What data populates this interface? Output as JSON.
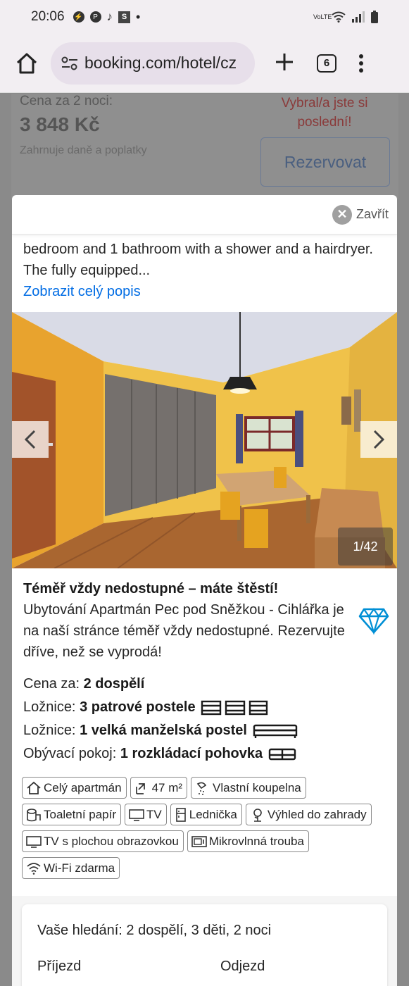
{
  "status_bar": {
    "time": "20:06",
    "icons": [
      "messenger-icon",
      "pinterest-icon",
      "tiktok-icon",
      "s-app-icon",
      "dot-icon"
    ],
    "right_icons": [
      "volte-icon",
      "wifi-icon",
      "signal-icon",
      "battery-icon"
    ],
    "volte_label": "VoLTE"
  },
  "browser": {
    "url": "booking.com/hotel/cz",
    "tab_count": "6"
  },
  "background_page": {
    "price_label": "Cena za 2 noci:",
    "price": "3 848 Kč",
    "taxes": "Zahrnuje daně a poplatky",
    "last_chance": "Vybral/a jste si poslední!",
    "reserve_button": "Rezervovat"
  },
  "modal": {
    "close_label": "Zavřít",
    "description": "bedroom and 1 bathroom with a shower and a hairdryer. The fully equipped...",
    "show_more": "Zobrazit celý popis",
    "gallery_counter": "1/42",
    "scarcity_title": "Téměř vždy nedostupné – máte štěstí!",
    "scarcity_text": "Ubytování Apartmán Pec pod Sněžkou - Cihlářka je na naší stránce téměř vždy nedostupné. Rezervujte dříve, než se vyprodá!",
    "specs": [
      {
        "label": "Cena za: ",
        "value": "2 dospělí"
      },
      {
        "label": "Ložnice: ",
        "value": "3 patrové postele"
      },
      {
        "label": "Ložnice: ",
        "value": "1 velká manželská postel"
      },
      {
        "label": "Obývací pokoj: ",
        "value": "1 rozkládací pohovka"
      }
    ],
    "facilities": [
      {
        "label": "Celý apartmán",
        "icon": "house-icon"
      },
      {
        "label": "47 m²",
        "icon": "floor-area-icon"
      },
      {
        "label": "Vlastní koupelna",
        "icon": "shower-icon"
      },
      {
        "label": "Toaletní papír",
        "icon": "toilet-paper-icon"
      },
      {
        "label": "TV",
        "icon": "tv-icon"
      },
      {
        "label": "Lednička",
        "icon": "fridge-icon"
      },
      {
        "label": "Výhled do zahrady",
        "icon": "garden-icon"
      },
      {
        "label": "TV s plochou obrazovkou",
        "icon": "flat-tv-icon"
      },
      {
        "label": "Mikrovlnná trouba",
        "icon": "microwave-icon"
      },
      {
        "label": "Wi-Fi zdarma",
        "icon": "wifi-icon"
      }
    ]
  },
  "search_summary": {
    "text": "Vaše hledání: 2 dospělí, 3 děti, 2 noci",
    "arrival_label": "Příjezd",
    "departure_label": "Odjezd"
  },
  "colors": {
    "link": "#006ce4",
    "diamond": "#008fd5"
  }
}
